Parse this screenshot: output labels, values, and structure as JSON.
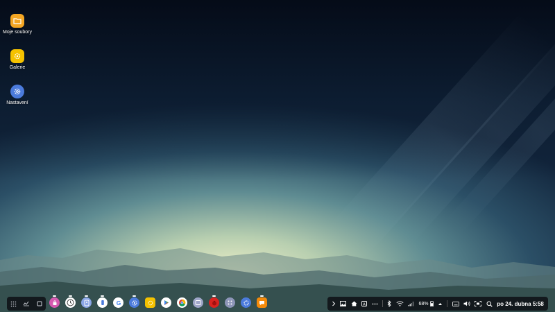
{
  "desktop": {
    "icons": [
      {
        "label": "Moje soubory",
        "icon": "folder-icon",
        "color": "#f4a623"
      },
      {
        "label": "Galerie",
        "icon": "gallery-flower-icon",
        "color": "#f5c200"
      },
      {
        "label": "Nastavení",
        "icon": "gear-icon",
        "color": "#4b7bdc"
      }
    ]
  },
  "taskbar": {
    "nav": [
      "apps-grid-icon",
      "recent-apps-icon",
      "home-square-icon"
    ],
    "dock_apps": [
      {
        "name": "galaxy-store-icon",
        "color": "#d65ab0"
      },
      {
        "name": "clock-icon",
        "color": "#ffffff"
      },
      {
        "name": "contacts-icon",
        "color": "#8aa6e6"
      },
      {
        "name": "phone-icon",
        "color": "#ffffff"
      },
      {
        "name": "google-icon",
        "color": "#ffffff"
      },
      {
        "name": "settings-icon",
        "color": "#4b7bdc"
      },
      {
        "name": "gallery-icon",
        "color": "#f5c200"
      },
      {
        "name": "play-store-icon",
        "color": "#ffffff"
      },
      {
        "name": "chrome-icon",
        "color": "#ffffff"
      },
      {
        "name": "smart-switch-icon",
        "color": "#9fa6c8"
      },
      {
        "name": "pomegranate-app-icon",
        "color": "#d8231f"
      },
      {
        "name": "samsung-apps-icon",
        "color": "#8d95b8"
      },
      {
        "name": "bixby-settings-icon",
        "color": "#4b7bdc"
      },
      {
        "name": "messages-icon",
        "color": "#f48a0a"
      }
    ],
    "tray": {
      "battery_percent": "68%",
      "datetime": "po 24. dubna 5:58"
    }
  },
  "colors": {
    "bar_bg": "#0c0e12",
    "accent_blue": "#4b7bdc"
  }
}
